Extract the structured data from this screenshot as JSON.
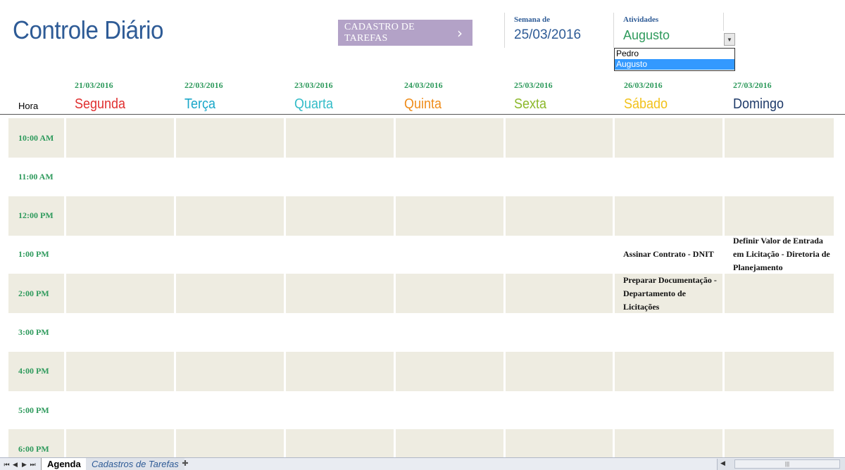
{
  "header": {
    "title": "Controle Diário",
    "cadastro_button": "CADASTRO DE TAREFAS",
    "semana_label": "Semana de",
    "semana_value": "25/03/2016",
    "atividades_label": "Atividades",
    "atividades_value": "Augusto",
    "dropdown_options": [
      "Pedro",
      "Augusto"
    ],
    "dropdown_selected_index": 1
  },
  "hora_label": "Hora",
  "days": [
    {
      "date": "21/03/2016",
      "name": "Segunda",
      "color": "#e03030"
    },
    {
      "date": "22/03/2016",
      "name": "Terça",
      "color": "#1aa7c9"
    },
    {
      "date": "23/03/2016",
      "name": "Quarta",
      "color": "#33bcc8"
    },
    {
      "date": "24/03/2016",
      "name": "Quinta",
      "color": "#ef8c1a"
    },
    {
      "date": "25/03/2016",
      "name": "Sexta",
      "color": "#8cb82a"
    },
    {
      "date": "26/03/2016",
      "name": "Sábado",
      "color": "#f2c21a"
    },
    {
      "date": "27/03/2016",
      "name": "Domingo",
      "color": "#1f3b6a"
    }
  ],
  "times": [
    "10:00 AM",
    "11:00 AM",
    "12:00 PM",
    "1:00 PM",
    "2:00 PM",
    "3:00 PM",
    "4:00 PM",
    "5:00 PM",
    "6:00 PM"
  ],
  "tasks": {
    "1:00 PM": {
      "5": "Assinar Contrato - DNIT",
      "6": "Definir Valor de Entrada em Licitação - Diretoria de Planejamento"
    },
    "2:00 PM": {
      "5": "Preparar Documentação - Departamento de Licitações"
    }
  },
  "sheet_tabs": [
    "Agenda",
    "Cadastros de Tarefas"
  ],
  "colors": {
    "title": "#2e5b96",
    "time": "#2e9a5c",
    "shaded_row": "#eeece1",
    "button_bg": "#b3a2c7"
  }
}
